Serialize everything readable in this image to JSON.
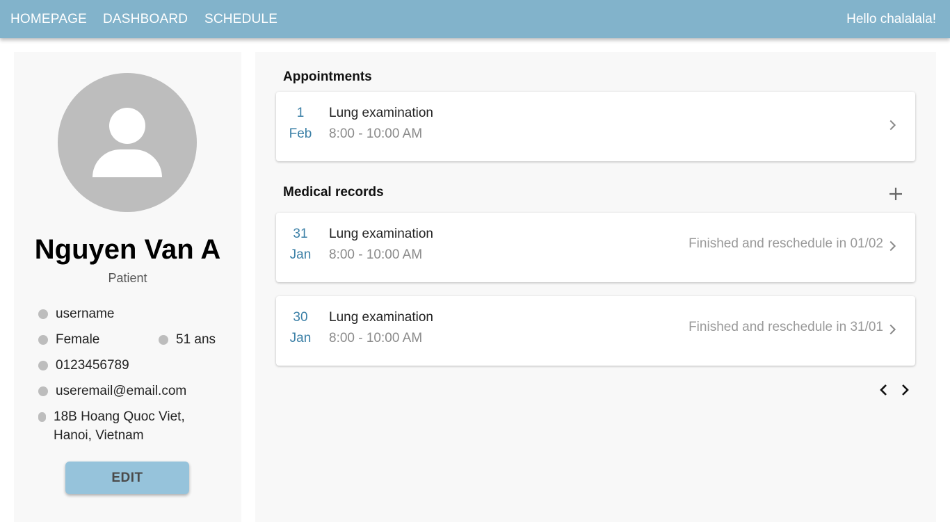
{
  "nav": {
    "links": [
      "HOMEPAGE",
      "DASHBOARD",
      "SCHEDULE"
    ],
    "greeting": "Hello chalalala!"
  },
  "profile": {
    "name": "Nguyen Van A",
    "role": "Patient",
    "username": "username",
    "gender": "Female",
    "age": "51 ans",
    "phone": "0123456789",
    "email": "useremail@email.com",
    "address_line1": "18B Hoang Quoc Viet,",
    "address_line2": "Hanoi, Vietnam",
    "edit_label": "EDIT"
  },
  "appointments": {
    "title": "Appointments",
    "items": [
      {
        "day": "1",
        "month": "Feb",
        "title": "Lung examination",
        "time": "8:00 - 10:00 AM"
      }
    ]
  },
  "records": {
    "title": "Medical records",
    "items": [
      {
        "day": "31",
        "month": "Jan",
        "title": "Lung examination",
        "time": "8:00 - 10:00 AM",
        "status": "Finished and reschedule in 01/02"
      },
      {
        "day": "30",
        "month": "Jan",
        "title": "Lung examination",
        "time": "8:00 - 10:00 AM",
        "status": "Finished and reschedule in 31/01"
      }
    ]
  },
  "icons": {
    "avatar": "person-avatar-icon",
    "chevron": "chevron-right-icon",
    "add": "plus-icon",
    "prev": "chevron-left-icon",
    "next": "chevron-right-icon"
  },
  "colors": {
    "nav_bg": "#82b3cb",
    "accent": "#3a7fa6",
    "edit_button": "#96c3db",
    "bullet": "#bdbdbd"
  }
}
